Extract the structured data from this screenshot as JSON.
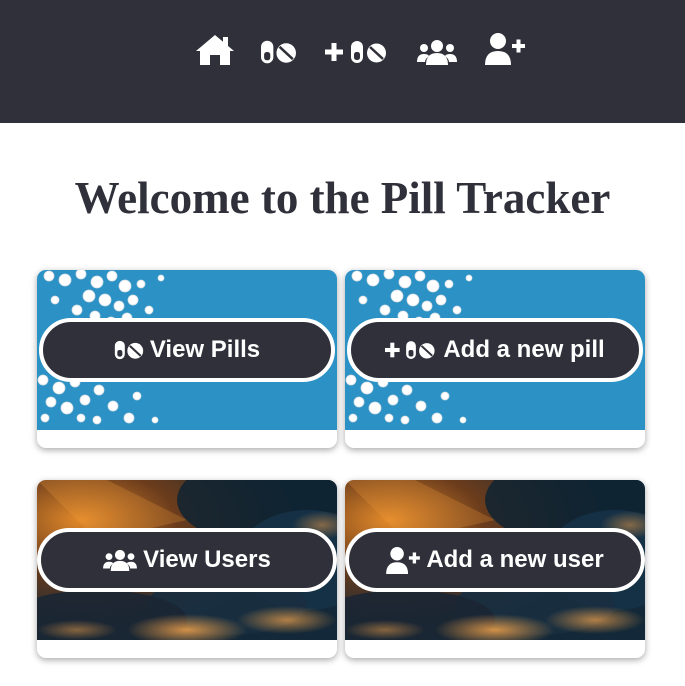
{
  "nav": {
    "items": [
      {
        "name": "home",
        "icon": "home-icon"
      },
      {
        "name": "pills",
        "icon": "pills-icon"
      },
      {
        "name": "add-pill",
        "icon": "plus-pills-icon"
      },
      {
        "name": "users",
        "icon": "users-icon"
      },
      {
        "name": "add-user",
        "icon": "user-plus-icon"
      }
    ]
  },
  "page": {
    "title": "Welcome to the Pill Tracker"
  },
  "cards": [
    {
      "label": "View Pills",
      "icon": "pills-icon",
      "image": "pills-on-blue-background"
    },
    {
      "label": "Add a new pill",
      "icon": "plus-pills-icon",
      "image": "pills-on-blue-background"
    },
    {
      "label": "View Users",
      "icon": "users-icon",
      "image": "cloudy-sunset-sky"
    },
    {
      "label": "Add a new user",
      "icon": "user-plus-icon",
      "image": "cloudy-sunset-sky"
    }
  ],
  "colors": {
    "navbar": "#2f3039",
    "button": "#2f3039",
    "title": "#2f3039",
    "pill_bg": "#2e97cb",
    "sky_dark": "#1c3a4f",
    "sky_orange": "#c8741e"
  }
}
